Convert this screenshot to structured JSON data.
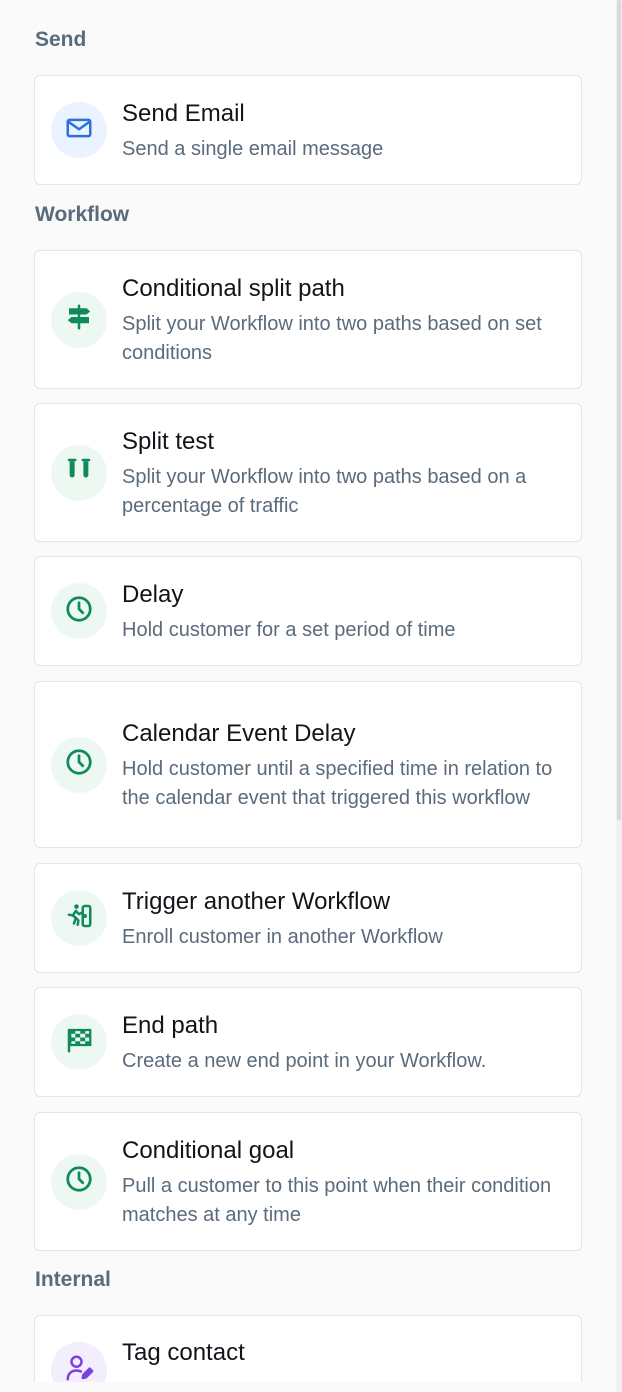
{
  "sections": {
    "send": {
      "title": "Send",
      "items": [
        {
          "title": "Send Email",
          "desc": "Send a single email message",
          "icon": "envelope-icon"
        }
      ]
    },
    "workflow": {
      "title": "Workflow",
      "items": [
        {
          "title": "Conditional split path",
          "desc": "Split your Workflow into two paths based on set conditions",
          "icon": "signpost-icon"
        },
        {
          "title": "Split test",
          "desc": "Split your Workflow into two paths based on a percentage of traffic",
          "icon": "test-tubes-icon"
        },
        {
          "title": "Delay",
          "desc": "Hold customer for a set period of time",
          "icon": "clock-icon"
        },
        {
          "title": "Calendar Event Delay",
          "desc": "Hold customer until a specified time in relation to the calendar event that triggered this workflow",
          "icon": "clock-icon"
        },
        {
          "title": "Trigger another Workflow",
          "desc": "Enroll customer in another Workflow",
          "icon": "person-running-door-icon"
        },
        {
          "title": "End path",
          "desc": "Create a new end point in your Workflow.",
          "icon": "finish-flag-icon"
        },
        {
          "title": "Conditional goal",
          "desc": "Pull a customer to this point when their condition matches at any time",
          "icon": "clock-icon"
        }
      ]
    },
    "internal": {
      "title": "Internal",
      "items": [
        {
          "title": "Tag contact",
          "desc": "",
          "icon": "user-edit-icon"
        }
      ]
    }
  },
  "colors": {
    "green_icon": "#0f8a5f",
    "blue_icon": "#2b6fe0",
    "purple_icon": "#7b3fe4",
    "section_title": "#5b6b7b"
  }
}
